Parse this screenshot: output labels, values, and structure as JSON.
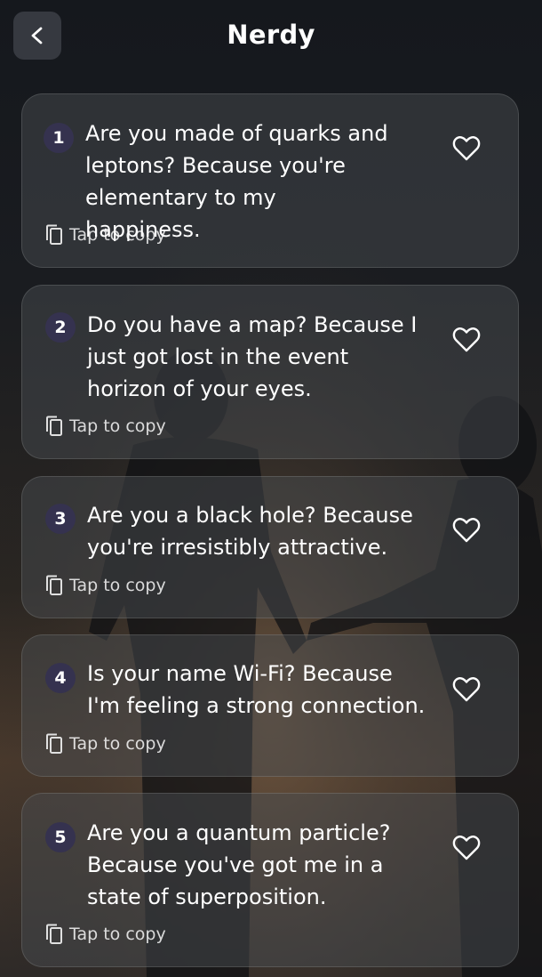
{
  "header": {
    "title": "Nerdy",
    "back_icon": "chevron-left-icon"
  },
  "lines": [
    {
      "number": "1",
      "text": "Are you made of quarks and leptons? Because you're elementary to my happiness.",
      "copy_label": "Tap to copy",
      "favorite_icon": "heart-outline-icon"
    },
    {
      "number": "2",
      "text": "Do you have a map? Because I just got lost in the event horizon of your eyes.",
      "copy_label": "Tap to copy",
      "favorite_icon": "heart-outline-icon"
    },
    {
      "number": "3",
      "text": "Are you a black hole? Because you're irresistibly attractive.",
      "copy_label": "Tap to copy",
      "favorite_icon": "heart-outline-icon"
    },
    {
      "number": "4",
      "text": "Is your name Wi-Fi? Because I'm feeling a strong connection.",
      "copy_label": "Tap to copy",
      "favorite_icon": "heart-outline-icon"
    },
    {
      "number": "5",
      "text": "Are you a quantum particle? Because you've got me in a state of superposition.",
      "copy_label": "Tap to copy",
      "favorite_icon": "heart-outline-icon"
    }
  ],
  "colors": {
    "badge": "#35324f",
    "card": "#4a4d52"
  }
}
